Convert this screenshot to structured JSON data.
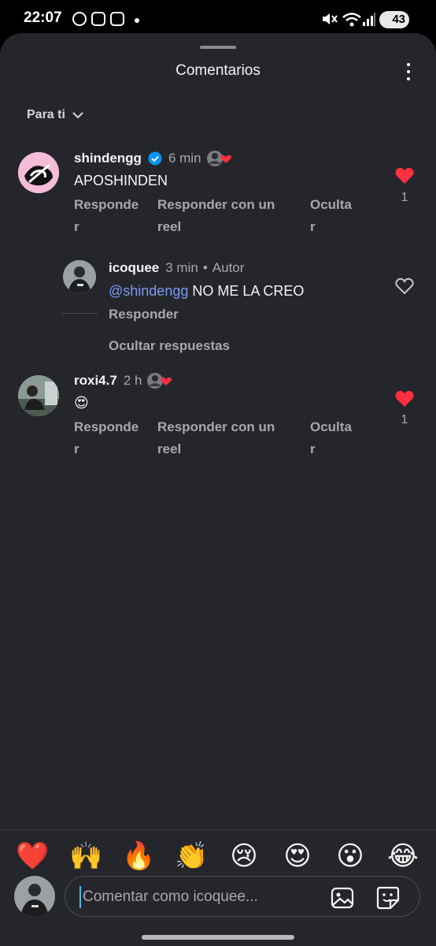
{
  "status_bar": {
    "time": "22:07",
    "battery": "43"
  },
  "sheet": {
    "title": "Comentarios",
    "sort_label": "Para ti"
  },
  "comments": [
    {
      "username": "shindengg",
      "verified": true,
      "time": "6 min",
      "text": "APOSHINDEN",
      "actions": {
        "reply": "Responde\nr",
        "reply_reel": "Responder con un\nreel",
        "hide": "Oculta\nr"
      },
      "liked": true,
      "likes": "1",
      "creator_liked": true
    },
    {
      "username": "icoquee",
      "time": "3 min",
      "author_label": "Autor",
      "mention": "@shindengg",
      "text": " NO ME LA CREO",
      "actions": {
        "reply": "Responder"
      },
      "liked": false
    },
    {
      "username": "roxi4.7",
      "time": "2 h",
      "text": "😍",
      "actions": {
        "reply": "Responde\nr",
        "reply_reel": "Responder con un\nreel",
        "hide": "Oculta\nr"
      },
      "liked": true,
      "likes": "1",
      "creator_liked": true
    }
  ],
  "hide_replies": "Ocultar respuestas",
  "emoji_bar": [
    "❤️",
    "🙌",
    "🔥",
    "👏",
    "😢",
    "😍",
    "😮",
    "😂"
  ],
  "composer": {
    "placeholder": "Comentar como icoquee..."
  },
  "colors": {
    "sheet_bg": "#25262b",
    "like_red": "#ff3040",
    "verified_blue": "#0095f6",
    "mention_blue": "#7a9cf5"
  }
}
